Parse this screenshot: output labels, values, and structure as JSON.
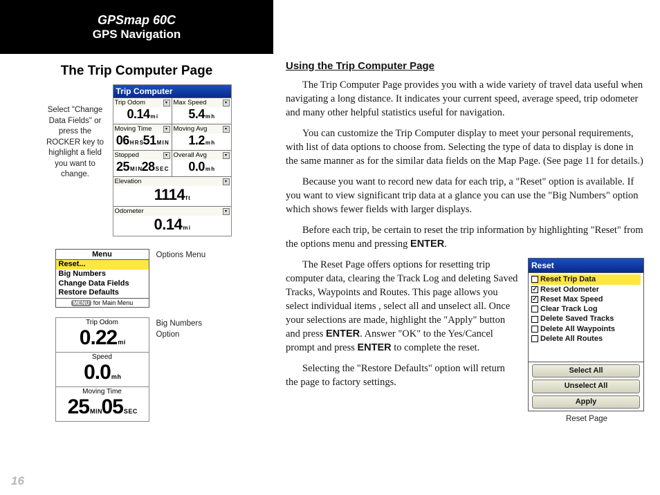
{
  "header": {
    "line1": "GPSmap 60C",
    "line2": "GPS Navigation"
  },
  "left": {
    "subtitle": "The Trip Computer Page",
    "side_caption": "Select \"Change Data Fields\" or press the ROCKER key to highlight a field you want to change.",
    "device_title": "Trip Computer",
    "fields": {
      "trip_odom": {
        "label": "Trip Odom",
        "value": "0.14",
        "unit": "m i"
      },
      "max_speed": {
        "label": "Max Speed",
        "value": "5.4",
        "unit": "m h"
      },
      "moving_time": {
        "label": "Moving Time",
        "value_h": "06",
        "unit_h": "H R S",
        "value_m": "51",
        "unit_m": "M I N"
      },
      "moving_avg": {
        "label": "Moving Avg",
        "value": "1.2",
        "unit": "m h"
      },
      "stopped": {
        "label": "Stopped",
        "value_m": "25",
        "unit_m": "M I N",
        "value_s": "28",
        "unit_s": "S E C"
      },
      "overall_avg": {
        "label": "Overall Avg",
        "value": "0.0",
        "unit": "m h"
      },
      "elevation": {
        "label": "Elevation",
        "value": "1114",
        "unit": "f t"
      },
      "odometer": {
        "label": "Odometer",
        "value": "0.14",
        "unit": "m i"
      }
    },
    "options_caption": "Options Menu",
    "menu": {
      "title": "Menu",
      "items": [
        "Reset...",
        "Big Numbers",
        "Change Data Fields",
        "Restore Defaults"
      ],
      "footer_btn": "MENU",
      "footer_text": "for Main Menu"
    },
    "bignum_caption": "Big Numbers Option",
    "bignum": {
      "trip_odom": {
        "label": "Trip Odom",
        "value": "0.22",
        "unit": "m i"
      },
      "speed": {
        "label": "Speed",
        "value": "0.0",
        "unit": "m h"
      },
      "moving_time": {
        "label": "Moving Time",
        "value_m": "25",
        "unit_m": "M I N",
        "value_s": "05",
        "unit_s": "S E C"
      }
    }
  },
  "right": {
    "heading": "Using the Trip Computer Page",
    "p1": "The Trip Computer Page provides you with a wide variety of travel data useful when navigating a long distance. It indicates your current speed, average speed, trip odometer and many other helpful statistics useful for navigation.",
    "p2": "You can customize the Trip Computer display to meet your personal requirements, with list of data options to choose from. Selecting the type of data to display is done in the same manner as for the similar data fields on the Map Page. (See page 11 for details.)",
    "p3": "Because you want to record new data for each trip, a \"Reset\" option is available. If you want to view significant trip data at a glance you can use the \"Big Numbers\" option which shows fewer fields with larger displays.",
    "p4a": "Before each trip, be certain to reset the trip information by highlighting \"Reset\" from the options menu and pressing ",
    "p4b": "ENTER",
    "p4c": ".",
    "p5a": "The Reset Page offers options for resetting trip computer data, clearing the Track Log and deleting Saved Tracks, Waypoints and Routes. This page allows you select individual items , select all and unselect all. Once your selections are made, highlight the \"Apply\" button and press ",
    "p5b": "ENTER",
    "p5c": ". Answer \"OK\" to the Yes/Cancel prompt and press ",
    "p5d": "ENTER",
    "p5e": " to complete the reset.",
    "p6": "Selecting the \"Restore Defaults\" option will return the page to factory settings."
  },
  "reset": {
    "title": "Reset",
    "items": [
      {
        "label": "Reset Trip Data",
        "checked": false,
        "sel": true
      },
      {
        "label": "Reset Odometer",
        "checked": true,
        "sel": false
      },
      {
        "label": "Reset Max Speed",
        "checked": true,
        "sel": false
      },
      {
        "label": "Clear Track Log",
        "checked": false,
        "sel": false
      },
      {
        "label": "Delete Saved Tracks",
        "checked": false,
        "sel": false
      },
      {
        "label": "Delete All Waypoints",
        "checked": false,
        "sel": false
      },
      {
        "label": "Delete All Routes",
        "checked": false,
        "sel": false
      }
    ],
    "buttons": [
      "Select All",
      "Unselect All",
      "Apply"
    ],
    "caption": "Reset Page"
  },
  "page_number": "16"
}
